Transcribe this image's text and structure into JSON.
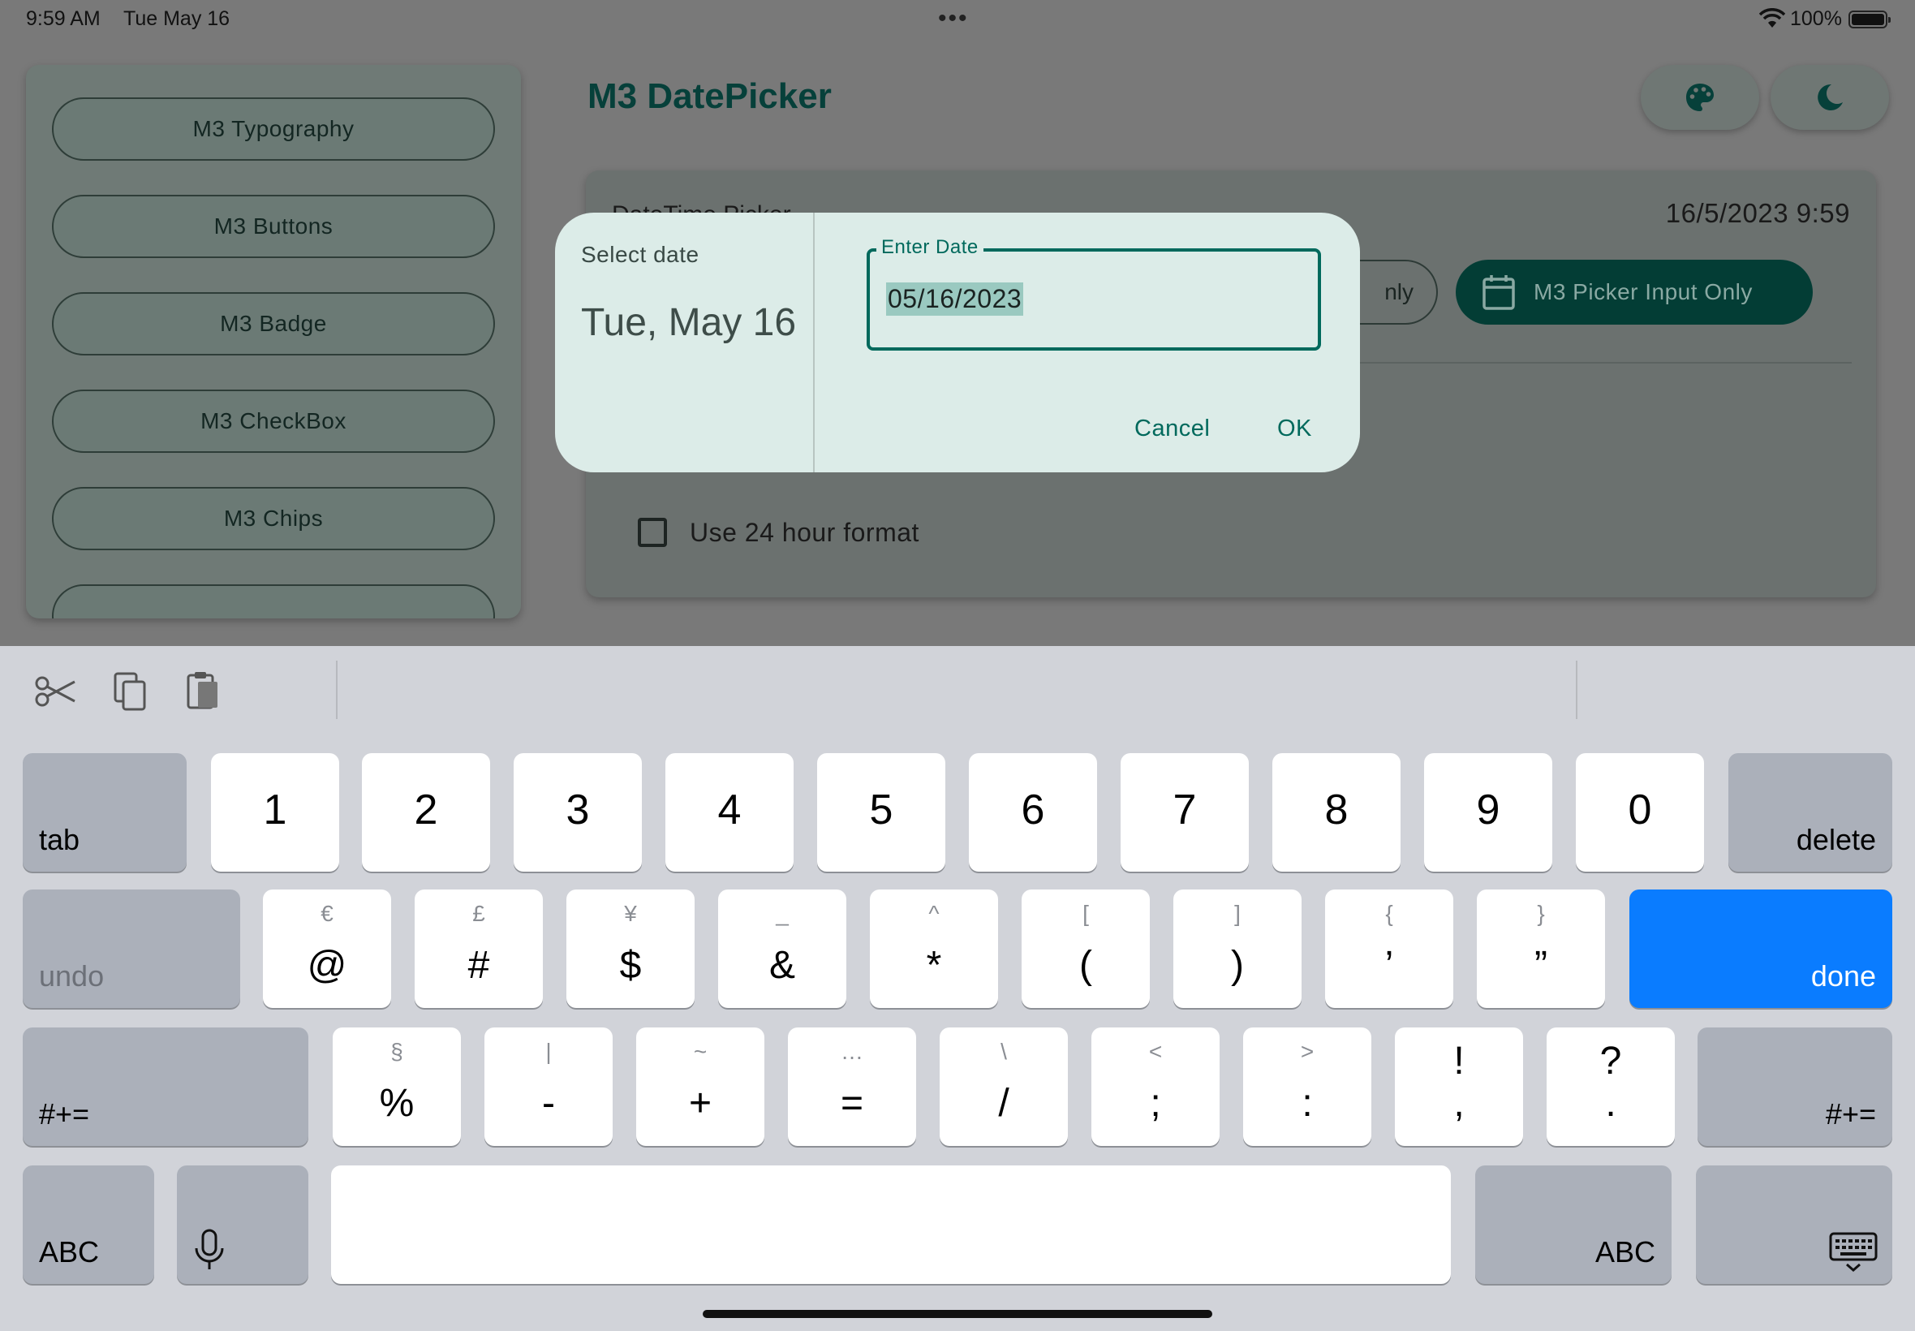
{
  "status_bar": {
    "time": "9:59 AM",
    "date": "Tue May 16",
    "dots": "•••",
    "battery_pct": "100%"
  },
  "sidebar": {
    "items": [
      {
        "label": "M3 Typography"
      },
      {
        "label": "M3 Buttons"
      },
      {
        "label": "M3 Badge"
      },
      {
        "label": "M3 CheckBox"
      },
      {
        "label": "M3 Chips"
      }
    ]
  },
  "header": {
    "title": "M3 DatePicker",
    "palette_icon": "palette-icon",
    "theme_icon": "dark-mode-moon-icon"
  },
  "card": {
    "heading": "DateTime Picker",
    "datetime_value": "16/5/2023 9:59",
    "partial_button_label": "nly",
    "picker_input_label": "M3 Picker Input Only",
    "checkbox_label": "Use 24 hour format"
  },
  "dialog": {
    "label": "Select date",
    "headline": "Tue, May 16",
    "field_label": "Enter Date",
    "field_value": "05/16/2023",
    "cancel_label": "Cancel",
    "ok_label": "OK"
  },
  "keyboard": {
    "row1": [
      "1",
      "2",
      "3",
      "4",
      "5",
      "6",
      "7",
      "8",
      "9",
      "0"
    ],
    "row2": [
      {
        "sub": "€",
        "main": "@"
      },
      {
        "sub": "£",
        "main": "#"
      },
      {
        "sub": "¥",
        "main": "$"
      },
      {
        "sub": "_",
        "main": "&"
      },
      {
        "sub": "^",
        "main": "*"
      },
      {
        "sub": "[",
        "main": "("
      },
      {
        "sub": "]",
        "main": ")"
      },
      {
        "sub": "{",
        "main": "’"
      },
      {
        "sub": "}",
        "main": "”"
      }
    ],
    "row3": [
      {
        "sub": "§",
        "main": "%"
      },
      {
        "sub": "|",
        "main": "-"
      },
      {
        "sub": "~",
        "main": "+"
      },
      {
        "sub": "…",
        "main": "="
      },
      {
        "sub": "\\",
        "main": "/"
      },
      {
        "sub": "<",
        "main": ";"
      },
      {
        "sub": ">",
        "main": ":"
      },
      {
        "sub": "!",
        "main": ","
      },
      {
        "sub": "?",
        "main": "."
      }
    ],
    "tab_label": "tab",
    "delete_label": "delete",
    "undo_label": "undo",
    "done_label": "done",
    "symbols_label": "#+=",
    "abc_label": "ABC",
    "done_color": "#0a7cff"
  }
}
